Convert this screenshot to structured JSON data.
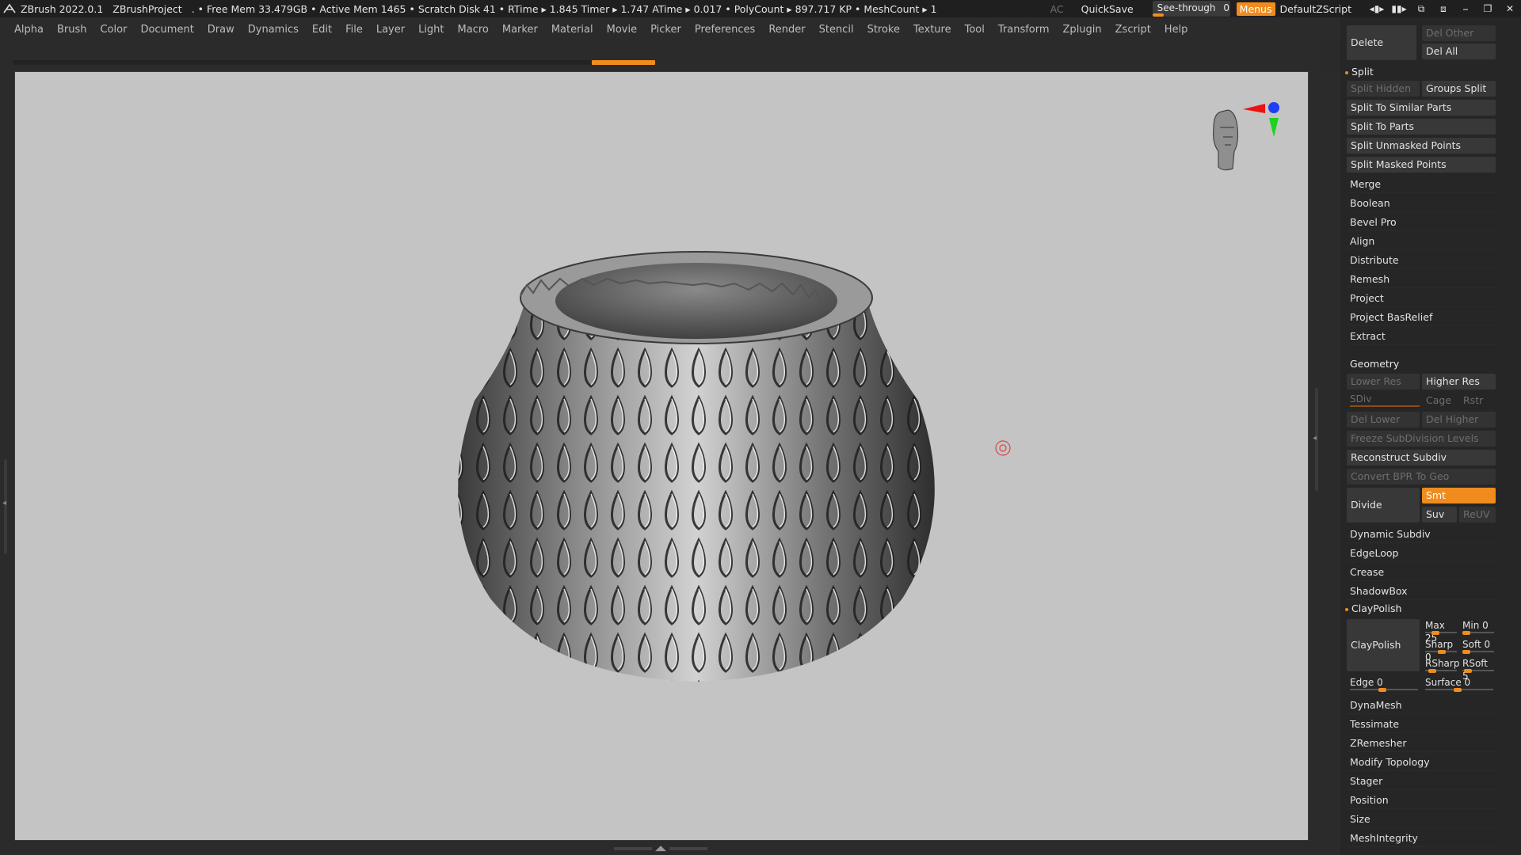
{
  "titlebar": {
    "app": "ZBrush 2022.0.1",
    "project": "ZBrushProject",
    "stats": ". • Free Mem 33.479GB • Active Mem 1465 • Scratch Disk 41 • RTime ▸ 1.845 Timer ▸ 1.747 ATime ▸ 0.017 • PolyCount ▸ 897.717 KP • MeshCount ▸ 1",
    "ac": "AC",
    "quicksave": "QuickSave",
    "seethrough_label": "See-through",
    "seethrough_value": "0",
    "menus": "Menus",
    "default_zscript": "DefaultZScript"
  },
  "menubar": {
    "items": [
      "Alpha",
      "Brush",
      "Color",
      "Document",
      "Draw",
      "Dynamics",
      "Edit",
      "File",
      "Layer",
      "Light",
      "Macro",
      "Marker",
      "Material",
      "Movie",
      "Picker",
      "Preferences",
      "Render",
      "Stencil",
      "Stroke",
      "Texture",
      "Tool",
      "Transform",
      "Zplugin",
      "Zscript",
      "Help"
    ]
  },
  "panel": {
    "delete": "Delete",
    "del_other": "Del Other",
    "del_all": "Del All",
    "split_title": "Split",
    "split_hidden": "Split Hidden",
    "groups_split": "Groups Split",
    "split_similar": "Split To Similar Parts",
    "split_parts": "Split To Parts",
    "split_unmasked": "Split Unmasked Points",
    "split_masked": "Split Masked Points",
    "subtool_items": [
      "Merge",
      "Boolean",
      "Bevel Pro",
      "Align",
      "Distribute",
      "Remesh",
      "Project",
      "Project BasRelief",
      "Extract"
    ],
    "geometry_title": "Geometry",
    "lower_res": "Lower Res",
    "higher_res": "Higher Res",
    "sdiv": "SDiv",
    "cage": "Cage",
    "rstr": "Rstr",
    "del_lower": "Del Lower",
    "del_higher": "Del Higher",
    "freeze_subdiv": "Freeze SubDivision Levels",
    "reconstruct": "Reconstruct Subdiv",
    "convert_bpr": "Convert BPR To Geo",
    "divide": "Divide",
    "smt": "Smt",
    "suv": "Suv",
    "reuv": "ReUV",
    "geo_items": [
      "Dynamic Subdiv",
      "EdgeLoop",
      "Crease",
      "ShadowBox"
    ],
    "claypolish_title": "ClayPolish",
    "claypolish_btn": "ClayPolish",
    "max": "Max 25",
    "min": "Min 0",
    "sharp": "Sharp",
    "sharp_val": "0",
    "soft": "Soft",
    "soft_val": "0",
    "rsharp": "RSharp",
    "rsoft": "RSoft",
    "rsoft_val": "5",
    "edge": "Edge",
    "edge_val": "0",
    "surface": "Surface",
    "surface_val": "0",
    "bottom_items": [
      "DynaMesh",
      "Tessimate",
      "ZRemesher",
      "Modify Topology",
      "Stager",
      "Position",
      "Size",
      "MeshIntegrity"
    ]
  },
  "colors": {
    "accent": "#f08c1e",
    "canvas": "#c4c4c4",
    "panel": "#262626"
  }
}
